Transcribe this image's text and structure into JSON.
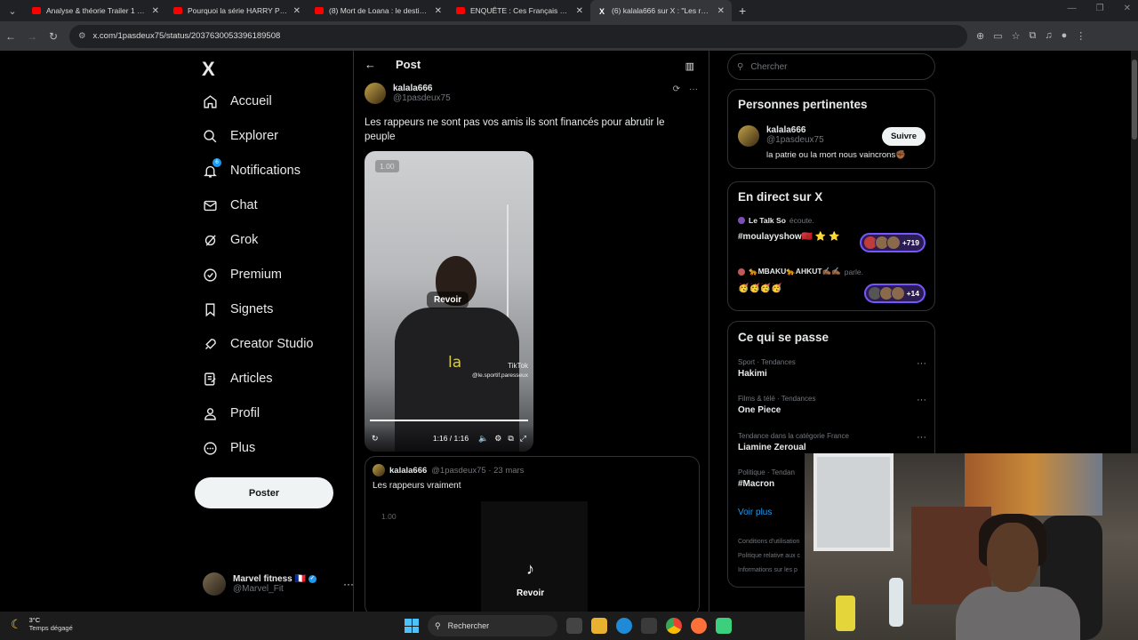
{
  "browser": {
    "tabs": [
      {
        "title": "Analyse & théorie Trailer 1 de l",
        "icon": "youtube-icon",
        "active": false
      },
      {
        "title": "Pourquoi la série HARRY POTT",
        "icon": "youtube-icon",
        "active": false
      },
      {
        "title": "(8) Mort de Loana : le destin b",
        "icon": "youtube-icon",
        "active": false
      },
      {
        "title": "ENQUÊTE : Ces Français prêts à",
        "icon": "youtube-icon",
        "active": false
      },
      {
        "title": "(6) kalala666 sur X : \"Les rappe",
        "icon": "x-icon",
        "active": true
      }
    ],
    "new_tab": "+",
    "url": "x.com/1pasdeux75/status/2037630053396189508"
  },
  "sidebar": {
    "logo": "X",
    "items": [
      {
        "label": "Accueil",
        "icon": "home-icon"
      },
      {
        "label": "Explorer",
        "icon": "search-icon"
      },
      {
        "label": "Notifications",
        "icon": "bell-icon",
        "badge": "6"
      },
      {
        "label": "Chat",
        "icon": "mail-icon"
      },
      {
        "label": "Grok",
        "icon": "grok-icon"
      },
      {
        "label": "Premium",
        "icon": "premium-icon"
      },
      {
        "label": "Signets",
        "icon": "bookmark-icon"
      },
      {
        "label": "Creator Studio",
        "icon": "rocket-icon"
      },
      {
        "label": "Articles",
        "icon": "article-icon"
      },
      {
        "label": "Profil",
        "icon": "user-icon"
      },
      {
        "label": "Plus",
        "icon": "more-circle-icon"
      }
    ],
    "post_button": "Poster",
    "account": {
      "name": "Marvel fitness 🇫🇷",
      "handle": "@Marvel_Fit"
    }
  },
  "post": {
    "header_title": "Post",
    "author_name": "kalala666",
    "author_handle": "@1pasdeux75",
    "text": "Les rappeurs ne sont pas vos amis ils sont financés pour abrutir le peuple",
    "video": {
      "speed": "1.00",
      "replay": "Revoir",
      "subtitle": "la",
      "watermark": "TikTok",
      "watermark_user": "@le.sportif.paresseux",
      "time": "1:16 / 1:16",
      "progress": 1.0
    },
    "quote": {
      "author_name": "kalala666",
      "meta": "@1pasdeux75 · 23 mars",
      "text": "Les rappeurs vraiment",
      "speed": "1.00",
      "replay": "Revoir"
    }
  },
  "right": {
    "search_placeholder": "Chercher",
    "relevant": {
      "title": "Personnes pertinentes",
      "name": "kalala666",
      "handle": "@1pasdeux75",
      "bio": "la patrie ou la mort nous vaincrons✊🏾",
      "follow": "Suivre"
    },
    "live": {
      "title": "En direct sur X",
      "items": [
        {
          "host": "Le Talk So",
          "action": "écoute.",
          "title": "#moulayyshow🇲🇦 ⭐ ⭐",
          "count": "+719"
        },
        {
          "host": "🐆MBAKU🐆AHKUT✍🏾✍🏾",
          "action": "parle.",
          "title": "🥳🥳🥳🥳",
          "count": "+14"
        }
      ]
    },
    "trends": {
      "title": "Ce qui se passe",
      "items": [
        {
          "category": "Sport · Tendances",
          "name": "Hakimi"
        },
        {
          "category": "Films & télé · Tendances",
          "name": "One Piece"
        },
        {
          "category": "Tendance dans la catégorie France",
          "name": "Liamine Zeroual"
        },
        {
          "category": "Politique · Tendan",
          "name": "#Macron"
        }
      ],
      "see_more": "Voir plus"
    },
    "footer": [
      "Conditions d'utilisation",
      "Politique relative aux c",
      "Informations sur les p"
    ]
  },
  "taskbar": {
    "temp": "3°C",
    "weather": "Temps dégagé",
    "search": "Rechercher"
  }
}
